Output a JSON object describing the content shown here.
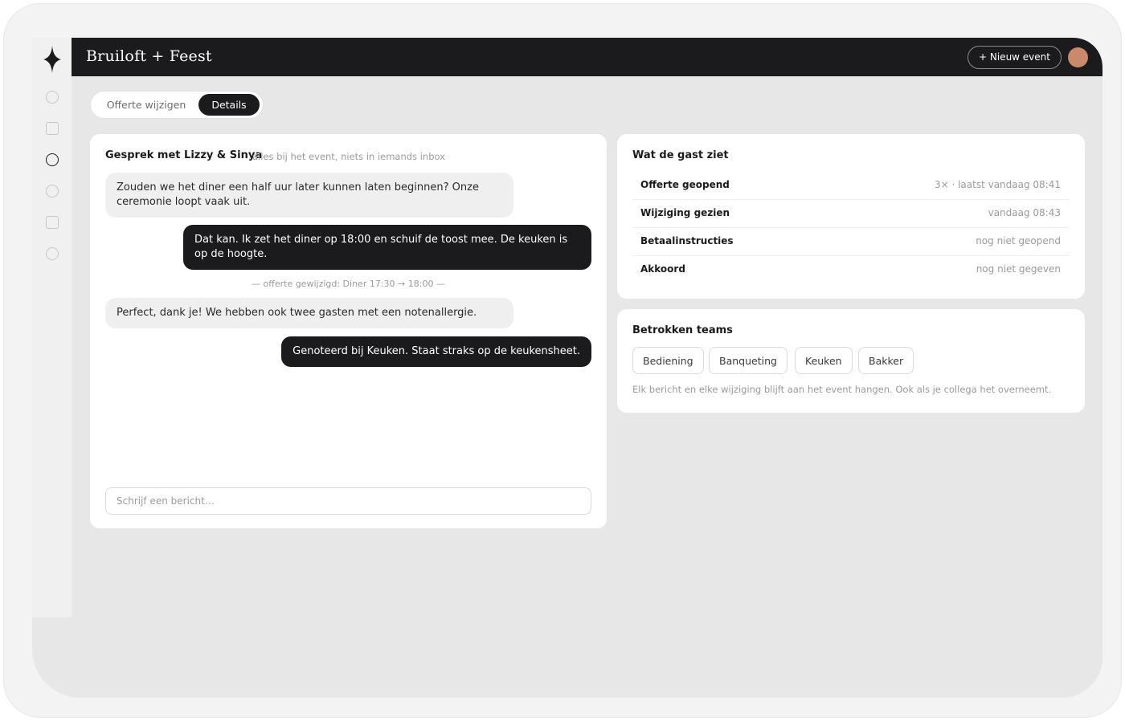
{
  "app": {
    "brand": "Bruiloft + Feest",
    "new_event_label": "+ Nieuw event"
  },
  "tabs": {
    "edit_quote": "Offerte wijzigen",
    "details": "Details",
    "active": "Details"
  },
  "chat": {
    "title": "Gesprek met Lizzy & Sinya",
    "subtitle": "alles bij het event, niets in iemands inbox",
    "messages": [
      {
        "direction": "in",
        "text": "Zouden we het diner een half uur later kunnen laten beginnen? Onze ceremonie loopt vaak uit."
      },
      {
        "direction": "out",
        "text": "Dat kan. Ik zet het diner op 18:00 en schuif de toost mee. De keuken is op de hoogte."
      },
      {
        "direction": "in",
        "text": "Perfect, dank je! We hebben ook twee gasten met een notenallergie."
      },
      {
        "direction": "out",
        "text": "Genoteerd bij Keuken. Staat straks op de keukensheet."
      }
    ],
    "system_note": "— offerte gewijzigd: Diner 17:30 → 18:00 —",
    "input_placeholder": "Schrijf een bericht…"
  },
  "guest_view": {
    "title": "Wat de gast ziet",
    "rows": [
      {
        "label": "Offerte geopend",
        "value": "3× · laatst vandaag 08:41"
      },
      {
        "label": "Wijziging gezien",
        "value": "vandaag 08:43"
      },
      {
        "label": "Betaalinstructies",
        "value": "nog niet geopend"
      },
      {
        "label": "Akkoord",
        "value": "nog niet gegeven"
      }
    ]
  },
  "teams": {
    "title": "Betrokken teams",
    "chips": [
      "Bediening",
      "Banqueting",
      "Keuken",
      "Bakker"
    ],
    "note": "Elk bericht en elke wijziging blijft aan het event hangen. Ook als je collega het overneemt."
  },
  "sidebar": {
    "icons": [
      "circle-icon",
      "square-icon",
      "circle-icon",
      "circle-icon",
      "square-icon",
      "circle-icon"
    ],
    "active_index": 2
  },
  "colors": {
    "dark": "#1b1b1d",
    "avatar": "#c9896a",
    "background": "#e7e7e7"
  }
}
